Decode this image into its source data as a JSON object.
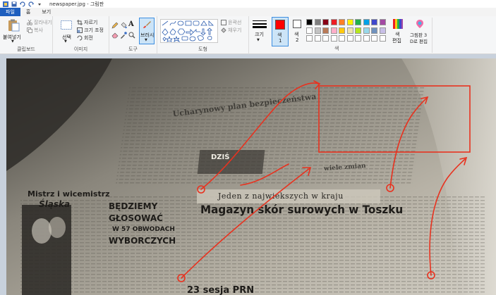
{
  "titlebar": {
    "title": "newspaper.jpg - 그림판"
  },
  "tabs": [
    {
      "label": "파일"
    },
    {
      "label": "홈"
    },
    {
      "label": "보기"
    }
  ],
  "ribbon": {
    "clipboard": {
      "paste": "붙여넣기",
      "cut": "잘라내기",
      "copy": "복사",
      "group": "클립보드"
    },
    "image": {
      "select": "선택",
      "crop": "자르기",
      "resize": "크기 조정",
      "rotate": "회전",
      "group": "이미지"
    },
    "tools": {
      "group": "도구"
    },
    "brush": {
      "label": "브러시"
    },
    "shapes": {
      "outline": "윤곽선",
      "fill": "채우기",
      "group": "도형"
    },
    "size": {
      "label": "크기"
    },
    "color1": {
      "label_a": "색",
      "label_b": "1",
      "value": "#ff0000"
    },
    "color2": {
      "label_a": "색",
      "label_b": "2",
      "value": "#ffffff"
    },
    "edit_colors": {
      "label_a": "색",
      "label_b": "편집"
    },
    "paint3d": {
      "label_a": "그림판 3",
      "label_b": "D로 편집"
    },
    "colors_group": "색",
    "palette": [
      "#000000",
      "#7f7f7f",
      "#880015",
      "#ed1c24",
      "#ff7f27",
      "#fff200",
      "#22b14c",
      "#00a2e8",
      "#3f48cc",
      "#a349a4",
      "#ffffff",
      "#c3c3c3",
      "#b97a57",
      "#ffaec9",
      "#ffc90e",
      "#efe4b0",
      "#b5e61d",
      "#99d9ea",
      "#7092be",
      "#c8bfe7",
      "#ffffff",
      "#ffffff",
      "#ffffff",
      "#ffffff",
      "#ffffff",
      "#ffffff",
      "#ffffff",
      "#ffffff",
      "#ffffff",
      "#ffffff"
    ]
  },
  "canvas": {
    "headline_jeden": "Jeden z najwiekszych w kraju",
    "headline_main": "Magazyn skór surowych w Toszku",
    "left_title_a": "Mistrz i wicemistrz",
    "left_title_b": "Śląska",
    "bedziemy_a": "BĘDZIEMY",
    "bedziemy_b": "GŁOSOWAĆ",
    "bedziemy_c": "W 57 OBWODACH",
    "bedziemy_d": "WYBORCZYCH",
    "bottom_head": "23 sesja PRN",
    "dzis": "DZIŚ",
    "top_strip": "Ucharynowy plan bezpieczeństwa",
    "side_note": "wiele zmian",
    "annotation_color": "#e8321f"
  }
}
